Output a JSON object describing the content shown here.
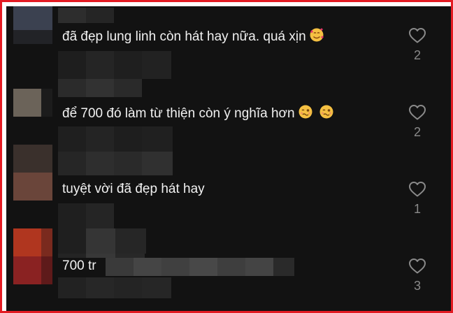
{
  "comments": [
    {
      "text": "đã đẹp lung linh còn hát hay nữa. quá xịn",
      "emoji": [
        "smiling-face-with-hearts-icon"
      ],
      "like_count": "2"
    },
    {
      "text": "để 700 đó làm từ thiện còn ý nghĩa hơn",
      "emoji": [
        "woozy-face-icon",
        "woozy-face-icon"
      ],
      "like_count": "2"
    },
    {
      "text": "tuyệt vời đã đẹp hát hay",
      "emoji": [],
      "like_count": "1"
    },
    {
      "text": "700 tr",
      "emoji": [],
      "like_count": "3"
    }
  ],
  "colors": {
    "frame_border": "#e31b23",
    "background": "#121212",
    "text": "#f1f1f1",
    "secondary_text": "#8a8a8a"
  }
}
